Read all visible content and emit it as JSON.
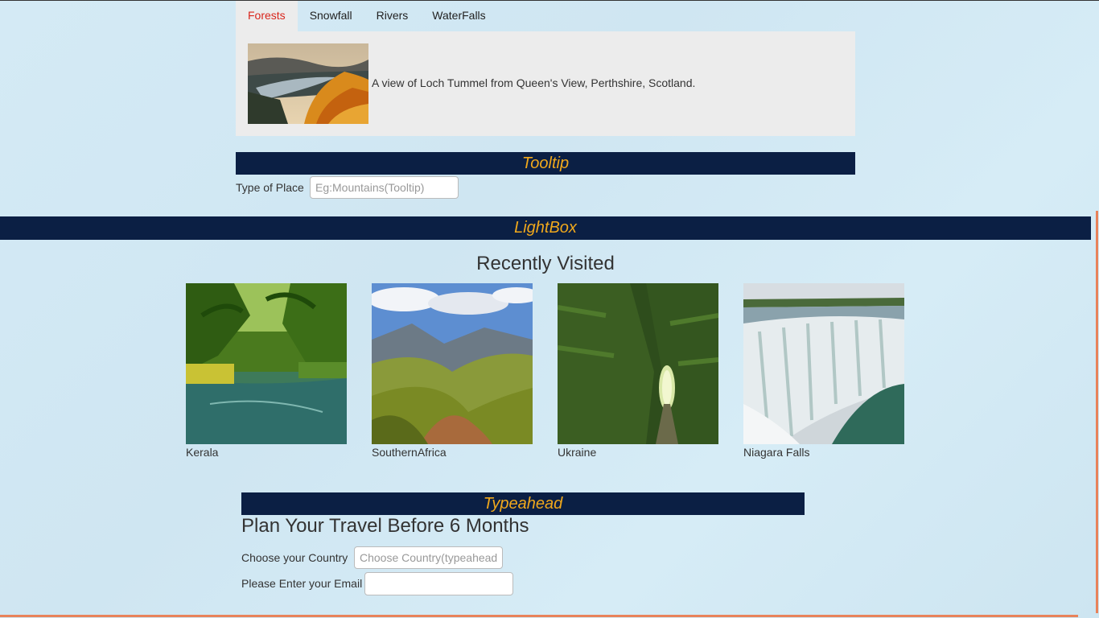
{
  "tabs": {
    "items": [
      {
        "label": "Forests",
        "active": true
      },
      {
        "label": "Snowfall",
        "active": false
      },
      {
        "label": "Rivers",
        "active": false
      },
      {
        "label": "WaterFalls",
        "active": false
      }
    ],
    "panel_caption": "A view of Loch Tummel from Queen's View, Perthshire, Scotland."
  },
  "tooltip": {
    "title": "Tooltip",
    "field_label": "Type of Place",
    "placeholder": "Eg:Mountains(Tooltip)",
    "value": ""
  },
  "lightbox": {
    "title": "LightBox",
    "heading": "Recently Visited",
    "items": [
      {
        "label": "Kerala"
      },
      {
        "label": "SouthernAfrica"
      },
      {
        "label": "Ukraine"
      },
      {
        "label": "Niagara Falls"
      }
    ]
  },
  "typeahead": {
    "title": "Typeahead",
    "heading": "Plan Your Travel Before 6 Months",
    "country_label": "Choose your Country",
    "country_placeholder": "Choose Country(typeahead)",
    "email_label": "Please Enter your Email",
    "email_value": ""
  },
  "colors": {
    "bar_bg": "#0b1f44",
    "bar_text": "#f0a81c",
    "active_tab_text": "#d9261c",
    "panel_bg": "#ececec",
    "accent_line": "#e8825a"
  }
}
